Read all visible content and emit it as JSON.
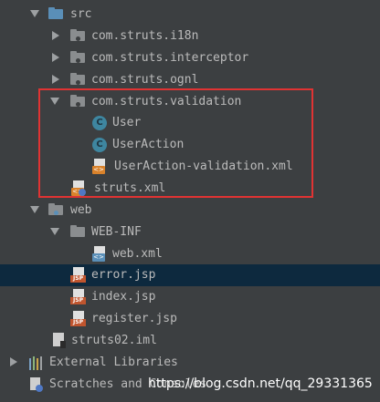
{
  "tree": {
    "src": "src",
    "pkg_i18n": "com.struts.i18n",
    "pkg_interceptor": "com.struts.interceptor",
    "pkg_ognl": "com.struts.ognl",
    "pkg_validation": "com.struts.validation",
    "class_user": "User",
    "class_useraction": "UserAction",
    "file_validation_xml": "UserAction-validation.xml",
    "file_struts_xml": "struts.xml",
    "web": "web",
    "web_inf": "WEB-INF",
    "file_web_xml": "web.xml",
    "file_error_jsp": "error.jsp",
    "file_index_jsp": "index.jsp",
    "file_register_jsp": "register.jsp",
    "file_iml": "struts02.iml",
    "external_libraries": "External Libraries",
    "scratches": "Scratches and Consoles"
  },
  "icons": {
    "jsp_badge": "JSP",
    "xml_badge": "<>",
    "class_badge": "C"
  },
  "colors": {
    "background": "#3c3f41",
    "selection": "#0d293e",
    "highlight_border": "#e03333",
    "folder_blue": "#5a8fb8",
    "folder_gray": "#8a8d8f"
  },
  "watermark": "https://blog.csdn.net/qq_29331365"
}
